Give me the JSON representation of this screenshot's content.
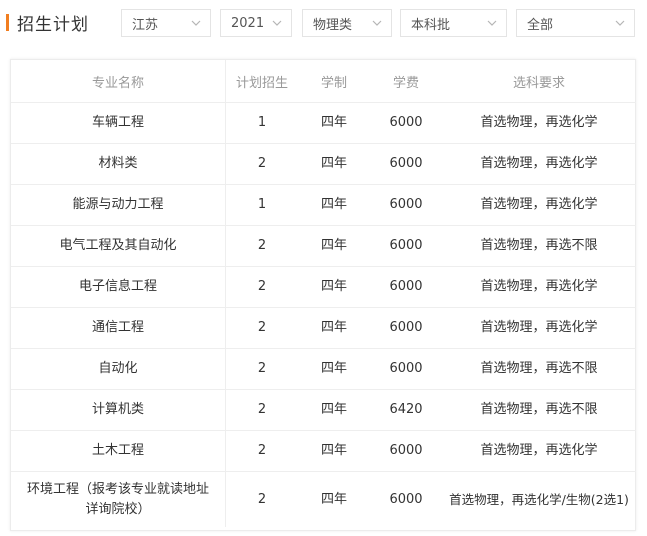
{
  "header": {
    "title": "招生计划"
  },
  "filters": [
    {
      "value": "江苏"
    },
    {
      "value": "2021"
    },
    {
      "value": "物理类"
    },
    {
      "value": "本科批"
    },
    {
      "value": "全部"
    }
  ],
  "table": {
    "headers": [
      "专业名称",
      "计划招生",
      "学制",
      "学费",
      "选科要求"
    ],
    "rows": [
      [
        "车辆工程",
        "1",
        "四年",
        "6000",
        "首选物理，再选化学"
      ],
      [
        "材料类",
        "2",
        "四年",
        "6000",
        "首选物理，再选化学"
      ],
      [
        "能源与动力工程",
        "1",
        "四年",
        "6000",
        "首选物理，再选化学"
      ],
      [
        "电气工程及其自动化",
        "2",
        "四年",
        "6000",
        "首选物理，再选不限"
      ],
      [
        "电子信息工程",
        "2",
        "四年",
        "6000",
        "首选物理，再选化学"
      ],
      [
        "通信工程",
        "2",
        "四年",
        "6000",
        "首选物理，再选化学"
      ],
      [
        "自动化",
        "2",
        "四年",
        "6000",
        "首选物理，再选不限"
      ],
      [
        "计算机类",
        "2",
        "四年",
        "6420",
        "首选物理，再选不限"
      ],
      [
        "土木工程",
        "2",
        "四年",
        "6000",
        "首选物理，再选化学"
      ],
      [
        "环境工程（报考该专业就读地址详询院校）",
        "2",
        "四年",
        "6000",
        "首选物理，再选化学/生物(2选1)"
      ]
    ]
  },
  "colors": {
    "accent": "#f17e20",
    "border": "#eeeeee",
    "header_text": "#999999"
  },
  "icons": {
    "dropdown": "chevron-down-icon"
  }
}
